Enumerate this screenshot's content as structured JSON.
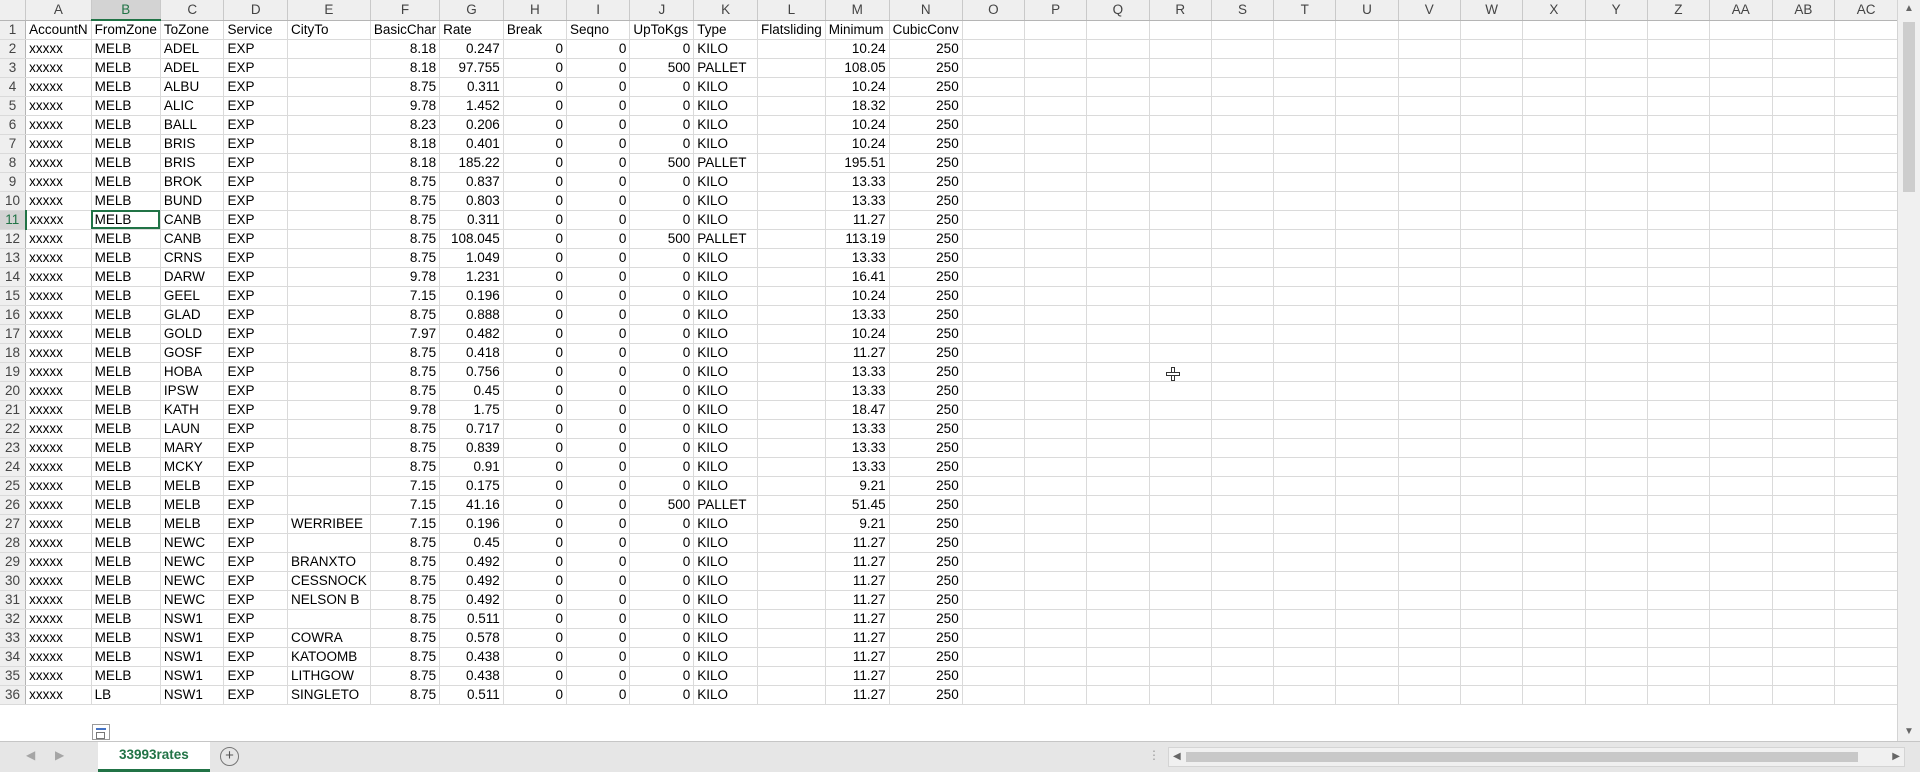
{
  "columns": [
    "A",
    "B",
    "C",
    "D",
    "E",
    "F",
    "G",
    "H",
    "I",
    "J",
    "K",
    "L",
    "M",
    "N",
    "O",
    "P",
    "Q",
    "R",
    "S",
    "T",
    "U",
    "V",
    "W",
    "X",
    "Y",
    "Z",
    "AA",
    "AB",
    "AC"
  ],
  "selected_column": "B",
  "selected_row": "11",
  "active_cell": "B11",
  "rows": [
    [
      "1",
      "AccountN",
      "FromZone",
      "ToZone",
      "Service",
      "CityTo",
      "BasicChar",
      "Rate",
      "Break",
      "Seqno",
      "UpToKgs",
      "Type",
      "Flatsliding",
      "Minimum",
      "CubicConv"
    ],
    [
      "2",
      "xxxxx",
      "MELB",
      "ADEL",
      "EXP",
      "",
      "8.18",
      "0.247",
      "0",
      "0",
      "0",
      "KILO",
      "",
      "10.24",
      "250"
    ],
    [
      "3",
      "xxxxx",
      "MELB",
      "ADEL",
      "EXP",
      "",
      "8.18",
      "97.755",
      "0",
      "0",
      "500",
      "PALLET",
      "",
      "108.05",
      "250"
    ],
    [
      "4",
      "xxxxx",
      "MELB",
      "ALBU",
      "EXP",
      "",
      "8.75",
      "0.311",
      "0",
      "0",
      "0",
      "KILO",
      "",
      "10.24",
      "250"
    ],
    [
      "5",
      "xxxxx",
      "MELB",
      "ALIC",
      "EXP",
      "",
      "9.78",
      "1.452",
      "0",
      "0",
      "0",
      "KILO",
      "",
      "18.32",
      "250"
    ],
    [
      "6",
      "xxxxx",
      "MELB",
      "BALL",
      "EXP",
      "",
      "8.23",
      "0.206",
      "0",
      "0",
      "0",
      "KILO",
      "",
      "10.24",
      "250"
    ],
    [
      "7",
      "xxxxx",
      "MELB",
      "BRIS",
      "EXP",
      "",
      "8.18",
      "0.401",
      "0",
      "0",
      "0",
      "KILO",
      "",
      "10.24",
      "250"
    ],
    [
      "8",
      "xxxxx",
      "MELB",
      "BRIS",
      "EXP",
      "",
      "8.18",
      "185.22",
      "0",
      "0",
      "500",
      "PALLET",
      "",
      "195.51",
      "250"
    ],
    [
      "9",
      "xxxxx",
      "MELB",
      "BROK",
      "EXP",
      "",
      "8.75",
      "0.837",
      "0",
      "0",
      "0",
      "KILO",
      "",
      "13.33",
      "250"
    ],
    [
      "10",
      "xxxxx",
      "MELB",
      "BUND",
      "EXP",
      "",
      "8.75",
      "0.803",
      "0",
      "0",
      "0",
      "KILO",
      "",
      "13.33",
      "250"
    ],
    [
      "11",
      "xxxxx",
      "MELB",
      "CANB",
      "EXP",
      "",
      "8.75",
      "0.311",
      "0",
      "0",
      "0",
      "KILO",
      "",
      "11.27",
      "250"
    ],
    [
      "12",
      "xxxxx",
      "MELB",
      "CANB",
      "EXP",
      "",
      "8.75",
      "108.045",
      "0",
      "0",
      "500",
      "PALLET",
      "",
      "113.19",
      "250"
    ],
    [
      "13",
      "xxxxx",
      "MELB",
      "CRNS",
      "EXP",
      "",
      "8.75",
      "1.049",
      "0",
      "0",
      "0",
      "KILO",
      "",
      "13.33",
      "250"
    ],
    [
      "14",
      "xxxxx",
      "MELB",
      "DARW",
      "EXP",
      "",
      "9.78",
      "1.231",
      "0",
      "0",
      "0",
      "KILO",
      "",
      "16.41",
      "250"
    ],
    [
      "15",
      "xxxxx",
      "MELB",
      "GEEL",
      "EXP",
      "",
      "7.15",
      "0.196",
      "0",
      "0",
      "0",
      "KILO",
      "",
      "10.24",
      "250"
    ],
    [
      "16",
      "xxxxx",
      "MELB",
      "GLAD",
      "EXP",
      "",
      "8.75",
      "0.888",
      "0",
      "0",
      "0",
      "KILO",
      "",
      "13.33",
      "250"
    ],
    [
      "17",
      "xxxxx",
      "MELB",
      "GOLD",
      "EXP",
      "",
      "7.97",
      "0.482",
      "0",
      "0",
      "0",
      "KILO",
      "",
      "10.24",
      "250"
    ],
    [
      "18",
      "xxxxx",
      "MELB",
      "GOSF",
      "EXP",
      "",
      "8.75",
      "0.418",
      "0",
      "0",
      "0",
      "KILO",
      "",
      "11.27",
      "250"
    ],
    [
      "19",
      "xxxxx",
      "MELB",
      "HOBA",
      "EXP",
      "",
      "8.75",
      "0.756",
      "0",
      "0",
      "0",
      "KILO",
      "",
      "13.33",
      "250"
    ],
    [
      "20",
      "xxxxx",
      "MELB",
      "IPSW",
      "EXP",
      "",
      "8.75",
      "0.45",
      "0",
      "0",
      "0",
      "KILO",
      "",
      "13.33",
      "250"
    ],
    [
      "21",
      "xxxxx",
      "MELB",
      "KATH",
      "EXP",
      "",
      "9.78",
      "1.75",
      "0",
      "0",
      "0",
      "KILO",
      "",
      "18.47",
      "250"
    ],
    [
      "22",
      "xxxxx",
      "MELB",
      "LAUN",
      "EXP",
      "",
      "8.75",
      "0.717",
      "0",
      "0",
      "0",
      "KILO",
      "",
      "13.33",
      "250"
    ],
    [
      "23",
      "xxxxx",
      "MELB",
      "MARY",
      "EXP",
      "",
      "8.75",
      "0.839",
      "0",
      "0",
      "0",
      "KILO",
      "",
      "13.33",
      "250"
    ],
    [
      "24",
      "xxxxx",
      "MELB",
      "MCKY",
      "EXP",
      "",
      "8.75",
      "0.91",
      "0",
      "0",
      "0",
      "KILO",
      "",
      "13.33",
      "250"
    ],
    [
      "25",
      "xxxxx",
      "MELB",
      "MELB",
      "EXP",
      "",
      "7.15",
      "0.175",
      "0",
      "0",
      "0",
      "KILO",
      "",
      "9.21",
      "250"
    ],
    [
      "26",
      "xxxxx",
      "MELB",
      "MELB",
      "EXP",
      "",
      "7.15",
      "41.16",
      "0",
      "0",
      "500",
      "PALLET",
      "",
      "51.45",
      "250"
    ],
    [
      "27",
      "xxxxx",
      "MELB",
      "MELB",
      "EXP",
      "WERRIBEE",
      "7.15",
      "0.196",
      "0",
      "0",
      "0",
      "KILO",
      "",
      "9.21",
      "250"
    ],
    [
      "28",
      "xxxxx",
      "MELB",
      "NEWC",
      "EXP",
      "",
      "8.75",
      "0.45",
      "0",
      "0",
      "0",
      "KILO",
      "",
      "11.27",
      "250"
    ],
    [
      "29",
      "xxxxx",
      "MELB",
      "NEWC",
      "EXP",
      "BRANXTO",
      "8.75",
      "0.492",
      "0",
      "0",
      "0",
      "KILO",
      "",
      "11.27",
      "250"
    ],
    [
      "30",
      "xxxxx",
      "MELB",
      "NEWC",
      "EXP",
      "CESSNOCK",
      "8.75",
      "0.492",
      "0",
      "0",
      "0",
      "KILO",
      "",
      "11.27",
      "250"
    ],
    [
      "31",
      "xxxxx",
      "MELB",
      "NEWC",
      "EXP",
      "NELSON B",
      "8.75",
      "0.492",
      "0",
      "0",
      "0",
      "KILO",
      "",
      "11.27",
      "250"
    ],
    [
      "32",
      "xxxxx",
      "MELB",
      "NSW1",
      "EXP",
      "",
      "8.75",
      "0.511",
      "0",
      "0",
      "0",
      "KILO",
      "",
      "11.27",
      "250"
    ],
    [
      "33",
      "xxxxx",
      "MELB",
      "NSW1",
      "EXP",
      "COWRA",
      "8.75",
      "0.578",
      "0",
      "0",
      "0",
      "KILO",
      "",
      "11.27",
      "250"
    ],
    [
      "34",
      "xxxxx",
      "MELB",
      "NSW1",
      "EXP",
      "KATOOMB",
      "8.75",
      "0.438",
      "0",
      "0",
      "0",
      "KILO",
      "",
      "11.27",
      "250"
    ],
    [
      "35",
      "xxxxx",
      "MELB",
      "NSW1",
      "EXP",
      "LITHGOW",
      "8.75",
      "0.438",
      "0",
      "0",
      "0",
      "KILO",
      "",
      "11.27",
      "250"
    ],
    [
      "36",
      "xxxxx",
      "LB",
      "NSW1",
      "EXP",
      "SINGLETO",
      "8.75",
      "0.511",
      "0",
      "0",
      "0",
      "KILO",
      "",
      "11.27",
      "250"
    ]
  ],
  "sheet_tab": {
    "label": "33993rates"
  },
  "add_sheet_label": "+",
  "colors": {
    "accent": "#217346",
    "grid": "#dadada",
    "header_bg": "#efefef"
  },
  "icons": {
    "cursor": "cell-select-cursor-icon",
    "paste": "paste-options-icon"
  }
}
